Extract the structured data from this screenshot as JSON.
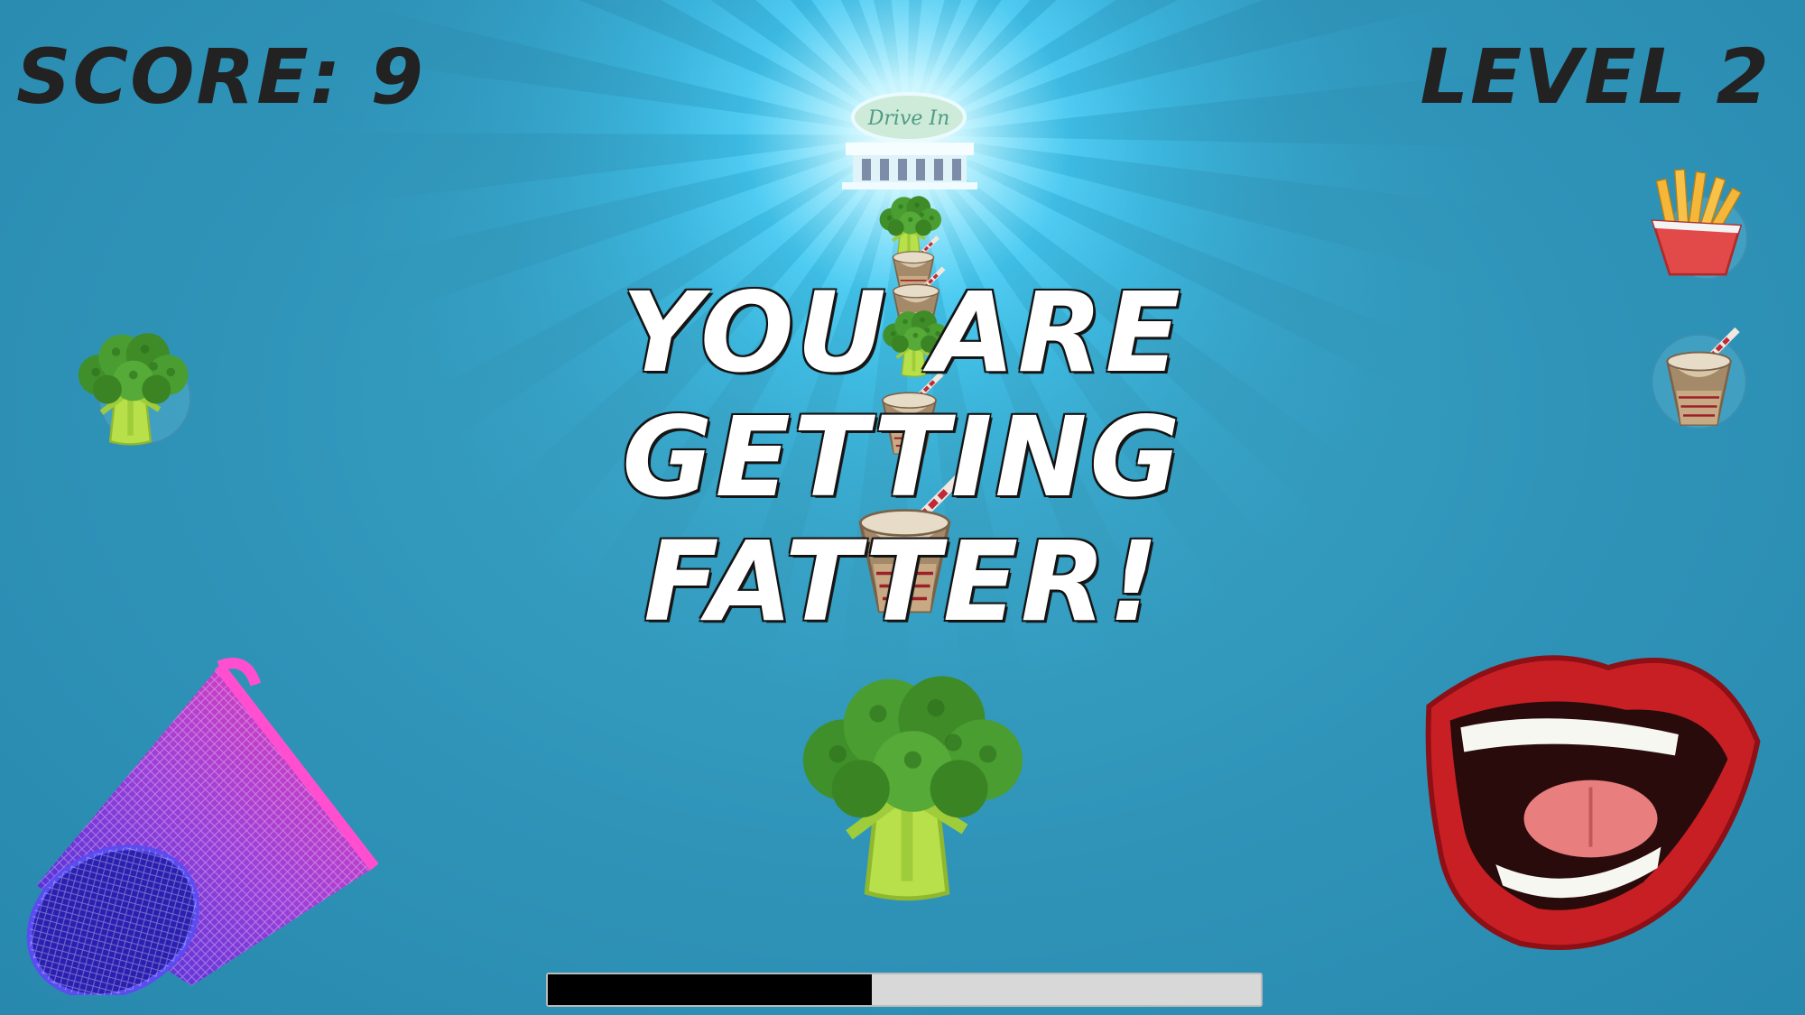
{
  "hud": {
    "score_text": "SCORE: 9",
    "level_text": "LEVEL 2"
  },
  "message": {
    "line1": "YOU ARE",
    "line2": "GETTING FATTER!"
  },
  "drive_in_sign": "Drive In",
  "progress": {
    "fraction": 0.455
  },
  "colors": {
    "background": "#2f93b8",
    "glow": "#bff3ff",
    "hud_text": "#222222",
    "message_text": "#ffffff",
    "progress_fill": "#000000",
    "progress_track": "#d8d8d8"
  },
  "icons": {
    "drive_in": "drive-in-diner-icon",
    "broccoli": "broccoli-icon",
    "milkshake": "milkshake-icon",
    "fries": "french-fries-icon",
    "trash": "trash-bin-icon",
    "mouth": "mouth-icon"
  }
}
